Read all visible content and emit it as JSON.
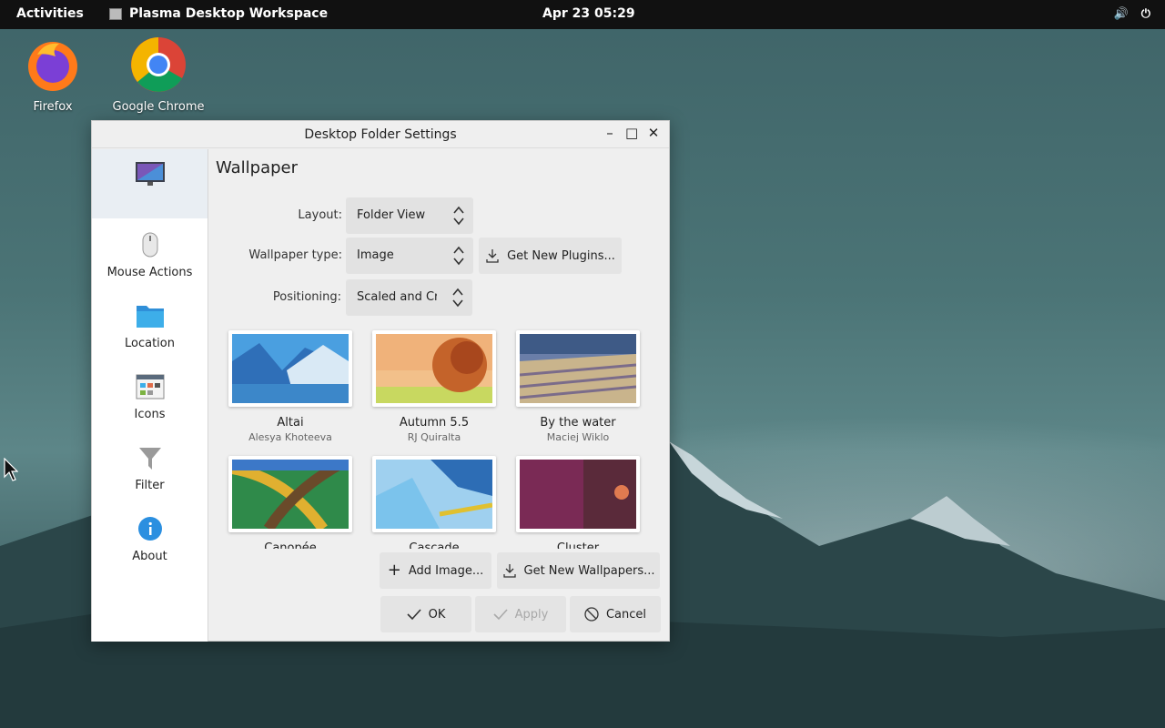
{
  "topbar": {
    "activities": "Activities",
    "app_title": "Plasma Desktop Workspace",
    "clock": "Apr 23  05:29",
    "tray_icons": [
      "volume-icon",
      "power-icon"
    ]
  },
  "desktop": {
    "icons": [
      {
        "label": "Firefox",
        "icon": "firefox-icon"
      },
      {
        "label": "Google Chrome",
        "icon": "chrome-icon"
      }
    ]
  },
  "window": {
    "title": "Desktop Folder Settings",
    "sidebar": [
      {
        "label": "",
        "icon": "monitor-icon",
        "active": true
      },
      {
        "label": "Mouse Actions",
        "icon": "mouse-icon"
      },
      {
        "label": "Location",
        "icon": "folder-icon"
      },
      {
        "label": "Icons",
        "icon": "icons-icon"
      },
      {
        "label": "Filter",
        "icon": "filter-icon"
      },
      {
        "label": "About",
        "icon": "info-icon"
      }
    ],
    "heading": "Wallpaper",
    "form": {
      "layout_label": "Layout:",
      "layout_value": "Folder View",
      "type_label": "Wallpaper type:",
      "type_value": "Image",
      "get_plugins": "Get New Plugins...",
      "positioning_label": "Positioning:",
      "positioning_value": "Scaled and Crop"
    },
    "wallpapers": [
      {
        "name": "Altai",
        "author": "Alesya Khoteeva"
      },
      {
        "name": "Autumn 5.5",
        "author": "RJ Quiralta"
      },
      {
        "name": "By the water",
        "author": "Maciej Wiklo"
      },
      {
        "name": "Canopée",
        "author": ""
      },
      {
        "name": "Cascade",
        "author": ""
      },
      {
        "name": "Cluster",
        "author": ""
      }
    ],
    "buttons": {
      "add_image": "Add Image...",
      "get_wallpapers": "Get New Wallpapers...",
      "ok": "OK",
      "apply": "Apply",
      "cancel": "Cancel"
    }
  }
}
